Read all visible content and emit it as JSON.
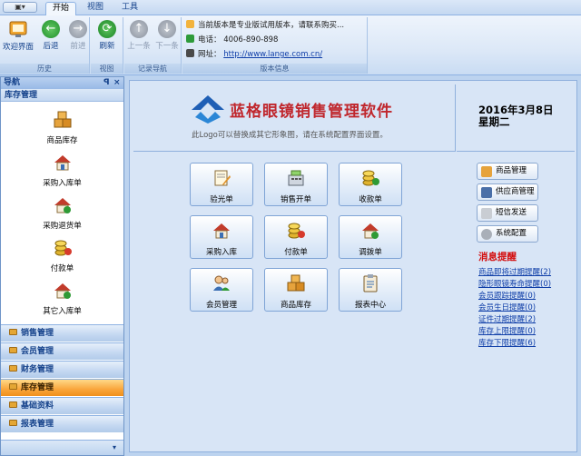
{
  "tabs": {
    "qat": "",
    "start": "开始",
    "view": "视图",
    "tools": "工具"
  },
  "ribbon": {
    "history": {
      "label": "历史",
      "home": "欢迎界面",
      "back": "后退",
      "forward": "前进"
    },
    "view": {
      "label": "视图",
      "refresh": "刷新"
    },
    "record_nav": {
      "label": "记录导航",
      "prev": "上一条",
      "next": "下一条"
    },
    "version": {
      "label": "版本信息",
      "notice": "当前版本是专业版试用版本，请联系购买...",
      "phone": "电话：  4006-890-898",
      "site_label": "网址：",
      "site_url": "http://www.lange.com.cn/"
    }
  },
  "nav": {
    "header": "导航",
    "pin": "ꟼ",
    "close": "×",
    "section": "库存管理",
    "items": [
      "商品库存",
      "采购入库单",
      "采购退货单",
      "付款单",
      "其它入库单"
    ],
    "sections": [
      "销售管理",
      "会员管理",
      "财务管理",
      "库存管理",
      "基础资料",
      "报表管理"
    ],
    "footer": "▾"
  },
  "main": {
    "title": "蓝格眼镜销售管理软件",
    "subtitle": "此Logo可以替换成其它形象图，请在系统配置界面设置。",
    "date": "2016年3月8日",
    "weekday": "星期二",
    "tiles": [
      "验光单",
      "销售开单",
      "收款单",
      "采购入库",
      "付款单",
      "调拨单",
      "会员管理",
      "商品库存",
      "报表中心"
    ],
    "side_buttons": [
      "商品管理",
      "供应商管理",
      "短信发送",
      "系统配置"
    ],
    "msg_title": "消息提醒",
    "messages": [
      "商品即将过期提醒(2)",
      "隐形眼镜寿命提醒(0)",
      "会员跟踪提醒(0)",
      "会员生日提醒(0)",
      "证件过期提醒(2)",
      "库存上限提醒(0)",
      "库存下限提醒(6)"
    ]
  },
  "colors": {
    "accent": "#15428b",
    "alert": "#d40b0b",
    "active_section": "#f9a53a"
  }
}
